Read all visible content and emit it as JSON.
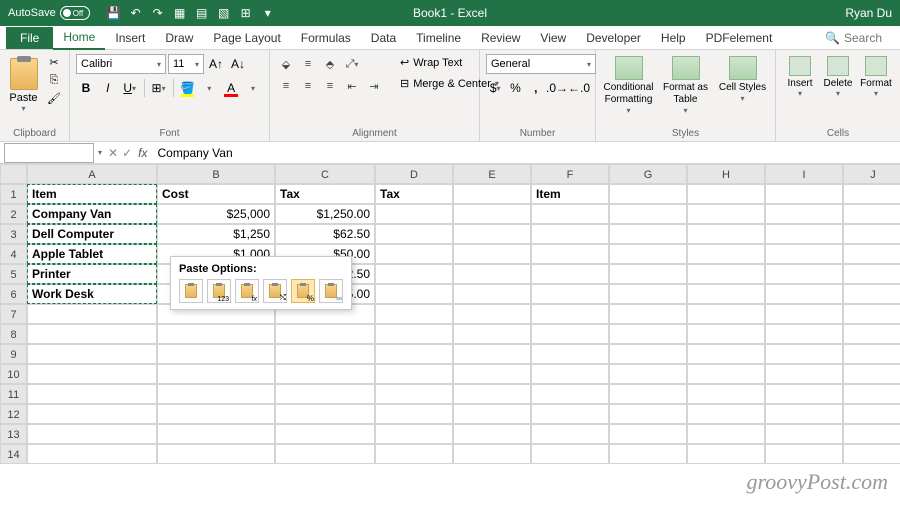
{
  "titlebar": {
    "autosave": "AutoSave",
    "toggle": "Off",
    "title": "Book1 - Excel",
    "user": "Ryan Du"
  },
  "menu": {
    "items": [
      "File",
      "Home",
      "Insert",
      "Draw",
      "Page Layout",
      "Formulas",
      "Data",
      "Timeline",
      "Review",
      "View",
      "Developer",
      "Help",
      "PDFelement"
    ],
    "search": "Search"
  },
  "ribbon": {
    "clipboard": {
      "paste": "Paste",
      "label": "Clipboard"
    },
    "font": {
      "name": "Calibri",
      "size": "11",
      "label": "Font"
    },
    "alignment": {
      "wrap": "Wrap Text",
      "merge": "Merge & Center",
      "label": "Alignment"
    },
    "number": {
      "format": "General",
      "label": "Number"
    },
    "styles": {
      "cond": "Conditional Formatting",
      "table": "Format as Table",
      "cell": "Cell Styles",
      "label": "Styles"
    },
    "cells": {
      "insert": "Insert",
      "delete": "Delete",
      "format": "Format",
      "label": "Cells"
    }
  },
  "formula": {
    "namebox": "",
    "value": "Company Van",
    "fx": "fx"
  },
  "cols": [
    "A",
    "B",
    "C",
    "D",
    "E",
    "F",
    "G",
    "H",
    "I",
    "J"
  ],
  "rows": [
    "1",
    "2",
    "3",
    "4",
    "5",
    "6",
    "7",
    "8",
    "9",
    "10",
    "11",
    "12",
    "13",
    "14"
  ],
  "cells": {
    "A1": "Item",
    "B1": "Cost",
    "C1": "Tax",
    "D1": "Tax",
    "F1": "Item",
    "A2": "Company Van",
    "B2": "$25,000",
    "C2": "$1,250.00",
    "A3": "Dell Computer",
    "B3": "$1,250",
    "C3": "$62.50",
    "A4": "Apple Tablet",
    "B4": "$1,000",
    "C4": "$50.00",
    "A5": "Printer",
    "C5": "$12.50",
    "A6": "Work Desk",
    "C6": "$15.00"
  },
  "paste_popup": {
    "title": "Paste Options:"
  },
  "watermark": "groovyPost.com"
}
